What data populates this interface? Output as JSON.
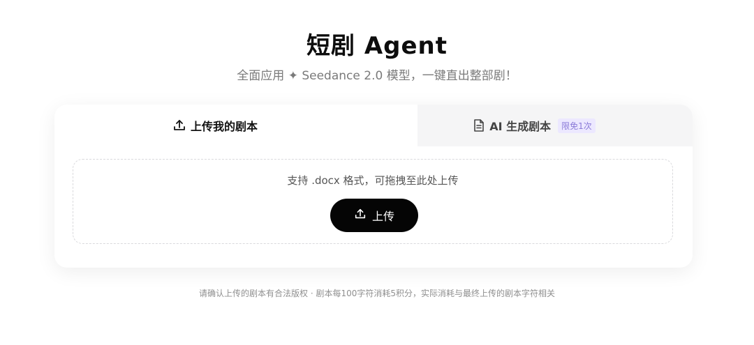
{
  "header": {
    "title": "短剧 Agent",
    "subtitle": "全面应用 ✦ Seedance 2.0 模型，一键直出整部剧！"
  },
  "tabs": [
    {
      "label": "上传我的剧本",
      "icon": "upload-icon",
      "active": true
    },
    {
      "label": "AI 生成剧本",
      "icon": "document-icon",
      "active": false,
      "badge": "限免1次"
    }
  ],
  "dropzone": {
    "hint": "支持 .docx 格式，可拖拽至此处上传",
    "button_label": "上传",
    "button_icon": "upload-icon"
  },
  "footnote": "请确认上传的剧本有合法版权 · 剧本每100字符消耗5积分，实际消耗与最终上传的剧本字符相关",
  "colors": {
    "button_bg": "#050505",
    "badge_text": "#8b7bd8",
    "badge_bg": "#ece8ff",
    "inactive_tab_bg": "#f5f5f6"
  }
}
